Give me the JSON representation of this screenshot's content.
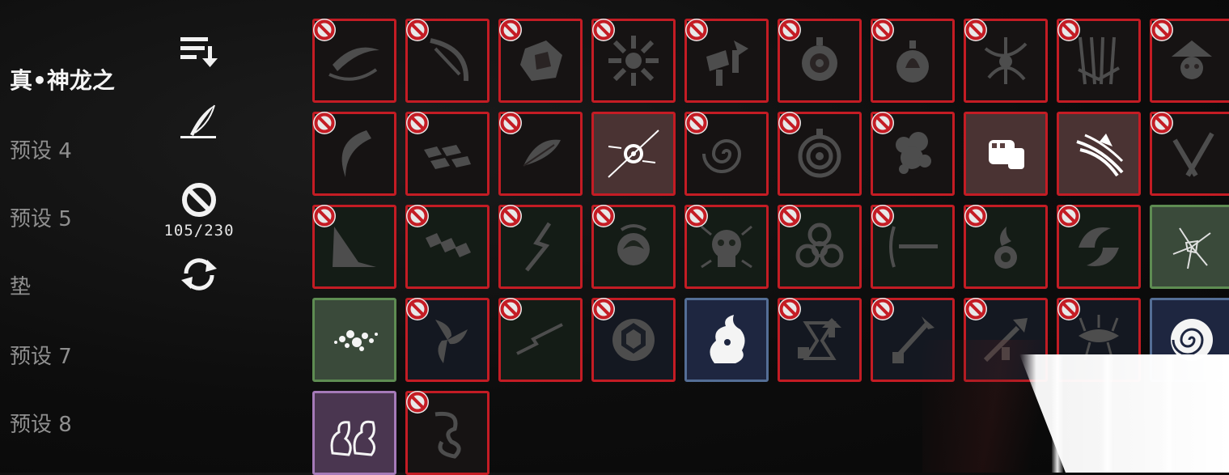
{
  "presets": [
    {
      "label": "真•神龙之",
      "active": true
    },
    {
      "label": "预设 4",
      "active": false
    },
    {
      "label": "预设 5",
      "active": false
    },
    {
      "label": "垫",
      "active": false
    },
    {
      "label": "预设 7",
      "active": false
    },
    {
      "label": "预设 8",
      "active": false
    }
  ],
  "toolbar": {
    "sort_icon": "sort-descending-icon",
    "edit_icon": "quill-pen-icon",
    "ban_icon": "ban-icon",
    "ban_count": "105/230",
    "refresh_icon": "refresh-icon"
  },
  "colors": {
    "banned_border": "#c41c24",
    "owned_green": "#5e8c52",
    "owned_blue": "#546e96",
    "owned_purple": "#a57ab8"
  },
  "skill_grid": {
    "rows": [
      [
        {
          "icon": "crescent-slash-icon",
          "banned": true,
          "state": "dark"
        },
        {
          "icon": "blade-swirl-icon",
          "banned": true,
          "state": "dark"
        },
        {
          "icon": "shattered-rock-icon",
          "banned": true,
          "state": "dark"
        },
        {
          "icon": "burst-splash-icon",
          "banned": true,
          "state": "dark"
        },
        {
          "icon": "hammer-arrow-icon",
          "banned": true,
          "state": "dark"
        },
        {
          "icon": "rune-orb-icon",
          "banned": true,
          "state": "dark"
        },
        {
          "icon": "flame-orb-icon",
          "banned": true,
          "state": "dark"
        },
        {
          "icon": "thorn-burst-icon",
          "banned": true,
          "state": "dark"
        },
        {
          "icon": "spear-volley-icon",
          "banned": true,
          "state": "dark"
        },
        {
          "icon": "skull-hat-icon",
          "banned": true,
          "state": "dark"
        }
      ],
      [
        {
          "icon": "crescent-claw-icon",
          "banned": true,
          "state": "dark"
        },
        {
          "icon": "tile-shards-icon",
          "banned": true,
          "state": "dark"
        },
        {
          "icon": "feather-icon",
          "banned": true,
          "state": "dark"
        },
        {
          "icon": "piercing-eye-icon",
          "banned": false,
          "state": "rose"
        },
        {
          "icon": "vortex-icon",
          "banned": true,
          "state": "dark"
        },
        {
          "icon": "concentric-target-icon",
          "banned": true,
          "state": "dark"
        },
        {
          "icon": "storm-cloud-icon",
          "banned": true,
          "state": "dark"
        },
        {
          "icon": "fist-gauntlet-icon",
          "banned": false,
          "state": "rose"
        },
        {
          "icon": "claw-slash-icon",
          "banned": false,
          "state": "rose"
        },
        {
          "icon": "cross-slash-icon",
          "banned": true,
          "state": "dark"
        }
      ],
      [
        {
          "icon": "ground-spike-icon",
          "banned": true,
          "state": "green"
        },
        {
          "icon": "chain-links-icon",
          "banned": true,
          "state": "green"
        },
        {
          "icon": "lightning-strike-icon",
          "banned": true,
          "state": "green"
        },
        {
          "icon": "fire-swirl-icon",
          "banned": true,
          "state": "green"
        },
        {
          "icon": "screaming-skull-icon",
          "banned": true,
          "state": "green"
        },
        {
          "icon": "biohazard-icon",
          "banned": true,
          "state": "green"
        },
        {
          "icon": "sword-beam-icon",
          "banned": true,
          "state": "green"
        },
        {
          "icon": "flame-bomb-icon",
          "banned": true,
          "state": "green"
        },
        {
          "icon": "spinning-blade-icon",
          "banned": true,
          "state": "green"
        },
        {
          "icon": "cracked-glass-icon",
          "banned": false,
          "state": "owned-green"
        }
      ],
      [
        {
          "icon": "scatter-dots-icon",
          "banned": false,
          "state": "owned-green"
        },
        {
          "icon": "shuriken-icon",
          "banned": true,
          "state": "navy"
        },
        {
          "icon": "zigzag-bolt-icon",
          "banned": true,
          "state": "green"
        },
        {
          "icon": "hex-shield-icon",
          "banned": true,
          "state": "navy"
        },
        {
          "icon": "ghost-flame-icon",
          "banned": false,
          "state": "owned-blue"
        },
        {
          "icon": "hourglass-up-icon",
          "banned": true,
          "state": "navy"
        },
        {
          "icon": "sword-up-icon",
          "banned": true,
          "state": "navy"
        },
        {
          "icon": "blade-up-icon",
          "banned": true,
          "state": "navy"
        },
        {
          "icon": "spiked-beast-icon",
          "banned": true,
          "state": "navy"
        },
        {
          "icon": "spiral-snail-icon",
          "banned": false,
          "state": "owned-blue"
        }
      ],
      [
        {
          "icon": "fire-spirits-icon",
          "banned": false,
          "state": "owned-purple"
        },
        {
          "icon": "serpent-spirit-icon",
          "banned": true,
          "state": "dark"
        }
      ]
    ]
  }
}
